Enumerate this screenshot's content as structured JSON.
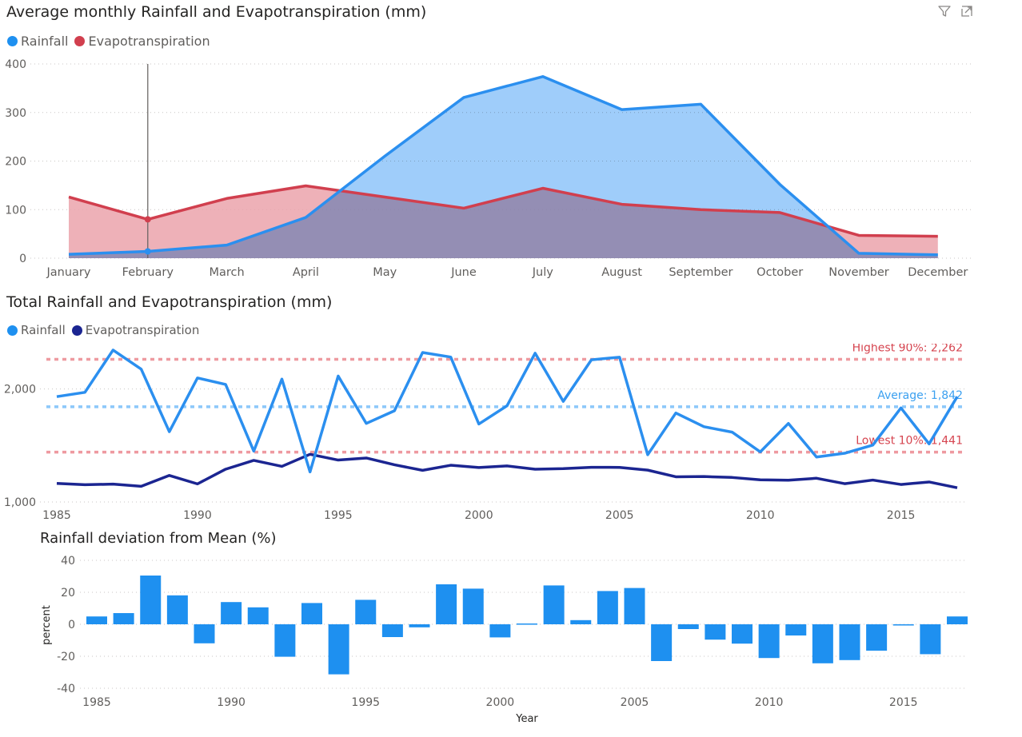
{
  "visual1": {
    "title": "Average monthly Rainfall and Evapotranspiration (mm)",
    "icons": [
      "filter-icon",
      "focus-mode-icon"
    ]
  },
  "visual2": {
    "title": "Total Rainfall and Evapotranspiration (mm)"
  },
  "visual3": {
    "title": "Rainfall deviation from Mean (%)"
  },
  "colors": {
    "rainfall": "#2B8FEF",
    "rainfall_area": "#8FC8FA",
    "evap": "#D13F4E",
    "evap_area": "#EBA3AC",
    "evap_total": "#1B2591",
    "highest": "#D64550",
    "average": "#3BA0F0",
    "bars": "#1E90F0"
  },
  "chart_data": [
    {
      "type": "area",
      "title": "Average monthly Rainfall and Evapotranspiration (mm)",
      "legend": [
        "Rainfall",
        "Evapotranspiration"
      ],
      "categories": [
        "January",
        "February",
        "March",
        "April",
        "May",
        "June",
        "July",
        "August",
        "September",
        "October",
        "November",
        "December"
      ],
      "series": [
        {
          "name": "Rainfall",
          "values": [
            8,
            14,
            27,
            84,
            210,
            331,
            374,
            306,
            317,
            152,
            10,
            7
          ]
        },
        {
          "name": "Evapotranspiration",
          "values": [
            126,
            80,
            123,
            149,
            126,
            103,
            144,
            111,
            100,
            94,
            47,
            45
          ]
        }
      ],
      "ylim": [
        0,
        400
      ],
      "yticks": [
        "0",
        "100",
        "200",
        "300",
        "400"
      ],
      "highlight_category": "February",
      "grid": true,
      "legend_position": "top-left"
    },
    {
      "type": "line",
      "title": "Total Rainfall and Evapotranspiration (mm)",
      "legend": [
        "Rainfall",
        "Evapotranspiration"
      ],
      "x": [
        1985,
        1986,
        1987,
        1988,
        1989,
        1990,
        1991,
        1992,
        1993,
        1994,
        1995,
        1996,
        1997,
        1998,
        1999,
        2000,
        2001,
        2002,
        2003,
        2004,
        2005,
        2006,
        2007,
        2008,
        2009,
        2010,
        2011,
        2012,
        2013,
        2014,
        2015,
        2016,
        2017
      ],
      "series": [
        {
          "name": "Rainfall",
          "values": [
            1932,
            1970,
            2344,
            2175,
            1622,
            2097,
            2040,
            1450,
            2087,
            1266,
            2114,
            1695,
            1807,
            2322,
            2282,
            1690,
            1851,
            2316,
            1890,
            2258,
            2281,
            1418,
            1787,
            1666,
            1618,
            1443,
            1695,
            1398,
            1431,
            1503,
            1832,
            1514,
            1932
          ]
        },
        {
          "name": "Evapotranspiration",
          "values": [
            1164,
            1153,
            1158,
            1139,
            1235,
            1160,
            1290,
            1368,
            1315,
            1422,
            1371,
            1389,
            1329,
            1280,
            1325,
            1305,
            1319,
            1290,
            1295,
            1307,
            1306,
            1282,
            1223,
            1225,
            1217,
            1196,
            1193,
            1210,
            1162,
            1194,
            1155,
            1177,
            1126
          ]
        }
      ],
      "ylim": [
        1000,
        2400
      ],
      "yticks": [
        "1,000",
        "2,000"
      ],
      "xticks": [
        "1985",
        "1990",
        "1995",
        "2000",
        "2005",
        "2010",
        "2015"
      ],
      "reference_lines": [
        {
          "label": "Highest 90%: 2,262",
          "value": 2262
        },
        {
          "label": "Average: 1,842",
          "value": 1842
        },
        {
          "label": "Lowest 10%: 1,441",
          "value": 1441
        }
      ],
      "grid": true,
      "legend_position": "top-left"
    },
    {
      "type": "bar",
      "title": "Rainfall deviation from Mean (%)",
      "x": [
        1985,
        1986,
        1987,
        1988,
        1989,
        1990,
        1991,
        1992,
        1993,
        1994,
        1995,
        1996,
        1997,
        1998,
        1999,
        2000,
        2001,
        2002,
        2003,
        2004,
        2005,
        2006,
        2007,
        2008,
        2009,
        2010,
        2011,
        2012,
        2013,
        2014,
        2015,
        2016,
        2017
      ],
      "values": [
        4.9,
        7.0,
        30.5,
        18.1,
        -11.9,
        13.9,
        10.6,
        -20.3,
        13.3,
        -31.3,
        15.3,
        -8.0,
        -1.9,
        25.0,
        22.3,
        -8.2,
        0.5,
        24.3,
        2.6,
        20.8,
        22.7,
        -23.0,
        -3.0,
        -9.6,
        -12.1,
        -21.1,
        -7.0,
        -24.4,
        -22.4,
        -16.5,
        -0.5,
        -18.7,
        4.9
      ],
      "xlabel": "Year",
      "ylabel": "percent",
      "ylim": [
        -40,
        40
      ],
      "yticks": [
        "-40",
        "-20",
        "0",
        "20",
        "40"
      ],
      "xticks": [
        "1985",
        "1990",
        "1995",
        "2000",
        "2005",
        "2010",
        "2015"
      ],
      "grid": true
    }
  ]
}
